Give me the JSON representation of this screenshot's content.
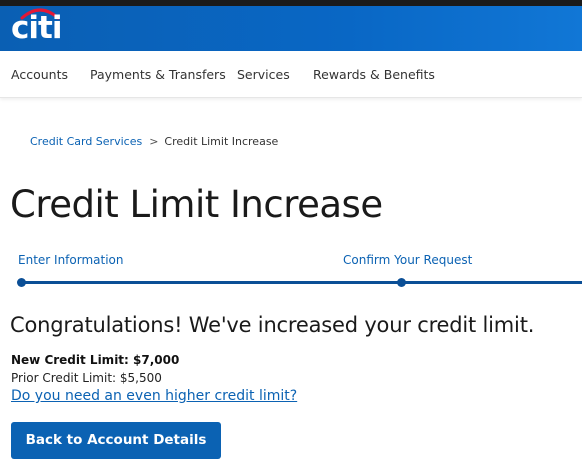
{
  "brand": {
    "logo_text": "citi"
  },
  "nav": {
    "items": [
      {
        "label": "Accounts"
      },
      {
        "label": "Payments & Transfers"
      },
      {
        "label": "Services"
      },
      {
        "label": "Rewards & Benefits"
      }
    ]
  },
  "breadcrumb": {
    "parent": "Credit Card Services",
    "separator": ">",
    "current": "Credit Limit Increase"
  },
  "page": {
    "title": "Credit Limit Increase"
  },
  "progress": {
    "steps": [
      {
        "label": "Enter Information"
      },
      {
        "label": "Confirm Your Request"
      }
    ]
  },
  "result": {
    "message": "Congratulations! We've increased your credit limit.",
    "new_limit": "New Credit Limit: $7,000",
    "prior_limit": "Prior Credit Limit: $5,500",
    "higher_link": "Do you need an even higher credit limit?"
  },
  "actions": {
    "back_label": "Back to Account Details"
  },
  "colors": {
    "brand_blue": "#0967c5",
    "link_blue": "#0b62b3",
    "progress_blue": "#0b4f96"
  }
}
